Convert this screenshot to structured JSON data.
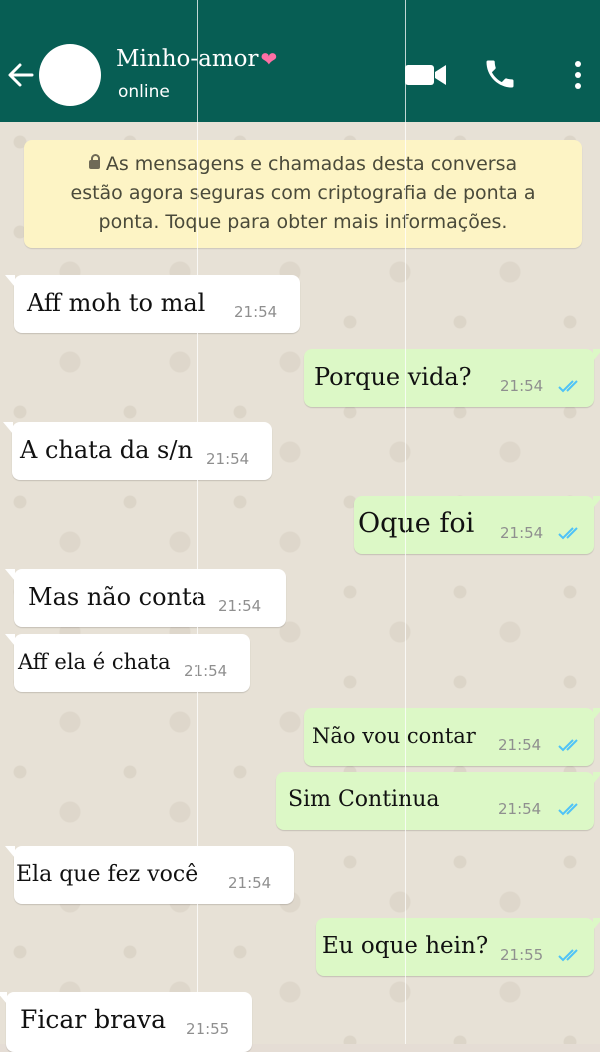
{
  "header": {
    "contact_name": "Minho-amor",
    "name_emoji": "❤",
    "status": "online",
    "icons": {
      "back": "arrow-back-icon",
      "avatar": "avatar",
      "video": "video-call-icon",
      "call": "phone-icon",
      "menu": "more-vertical-icon"
    }
  },
  "encryption_notice": {
    "line1": "As mensagens e chamadas desta conversa",
    "line2": "estão agora seguras com criptografia de ponta a",
    "line3": "ponta. Toque para obter mais informações."
  },
  "messages": [
    {
      "direction": "in",
      "text": "Aff moh to mal",
      "time": "21:54"
    },
    {
      "direction": "out",
      "text": "Porque vida?",
      "time": "21:54",
      "status": "read"
    },
    {
      "direction": "in",
      "text": "A chata da s/n",
      "time": "21:54"
    },
    {
      "direction": "out",
      "text": "Oque foi",
      "time": "21:54",
      "status": "read"
    },
    {
      "direction": "in",
      "text": "Mas não conta",
      "time": "21:54"
    },
    {
      "direction": "in",
      "text": "Aff ela é chata",
      "time": "21:54"
    },
    {
      "direction": "out",
      "text": "Não vou contar",
      "time": "21:54",
      "status": "read"
    },
    {
      "direction": "out",
      "text": "Sim Continua",
      "time": "21:54",
      "status": "read"
    },
    {
      "direction": "in",
      "text": "Ela que fez você",
      "time": "21:54"
    },
    {
      "direction": "out",
      "text": "Eu oque hein?",
      "time": "21:55",
      "status": "read"
    },
    {
      "direction": "in",
      "text": "Ficar brava",
      "time": "21:55"
    }
  ],
  "colors": {
    "header": "#075e54",
    "chat_background": "#e7e1d6",
    "incoming_bubble": "#ffffff",
    "outgoing_bubble": "#dcf8c6",
    "read_ticks": "#4fc3f7",
    "notice_background": "#fdf4c5"
  }
}
